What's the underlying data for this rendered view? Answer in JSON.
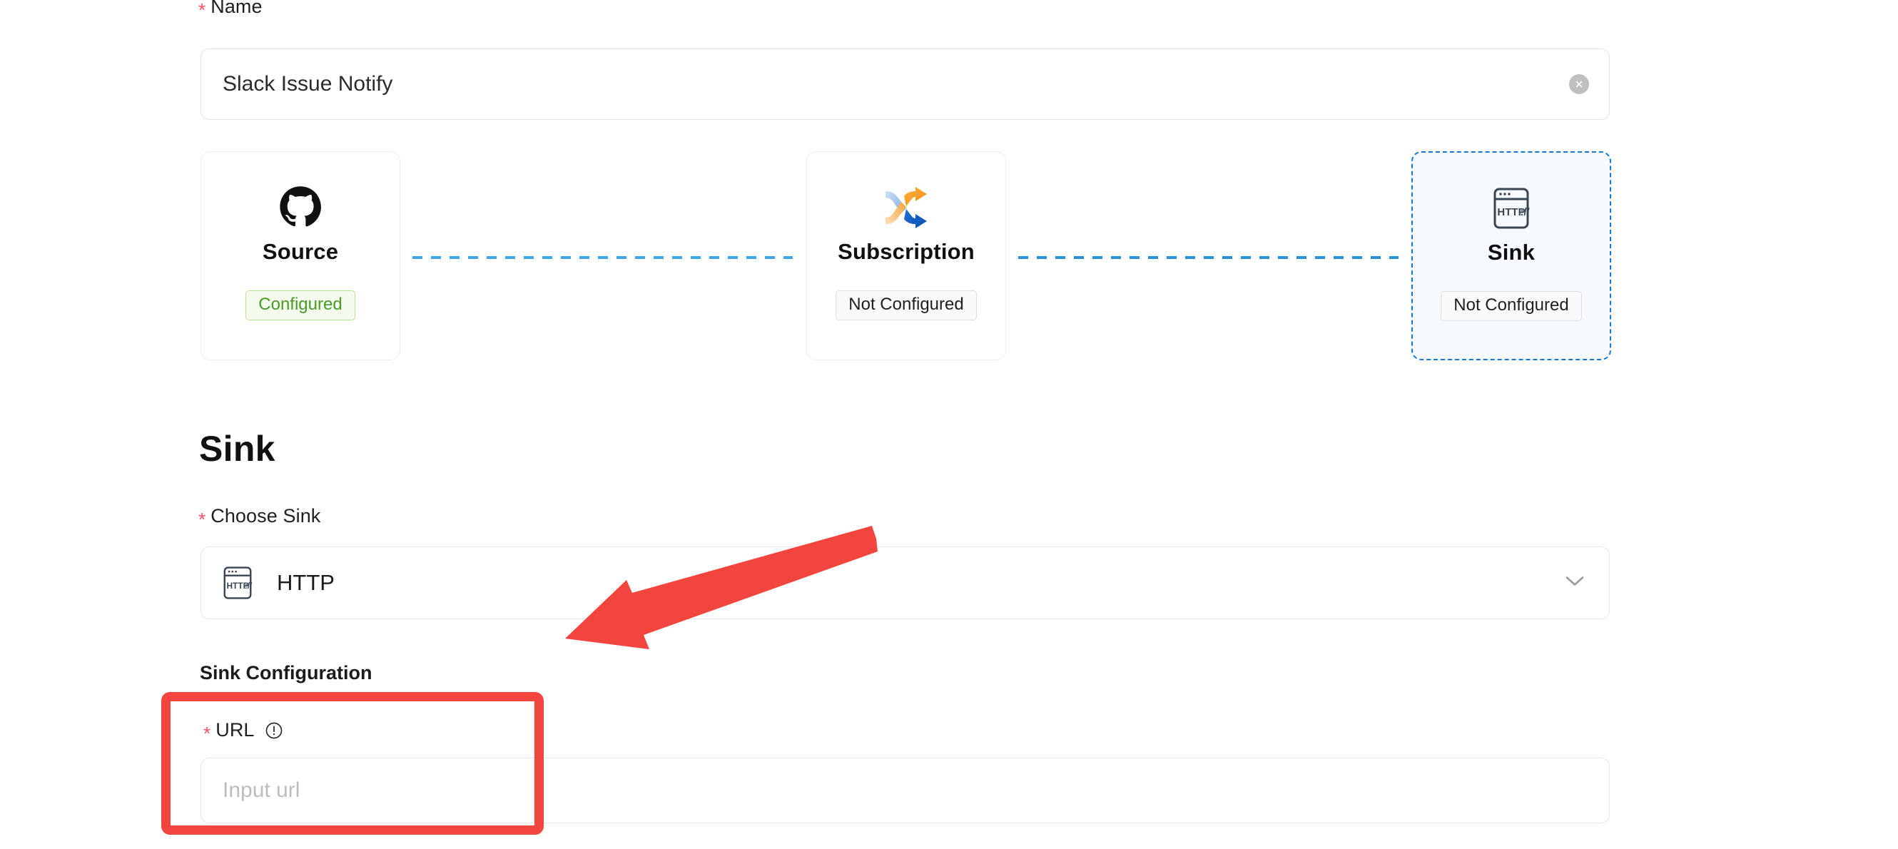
{
  "form": {
    "name_field": {
      "label": "Name",
      "required": true,
      "value": "Slack Issue Notify",
      "clear_icon": "close-circle-icon"
    }
  },
  "pipeline": {
    "steps": [
      {
        "title": "Source",
        "icon": "github-icon",
        "status": "Configured",
        "status_state": "configured",
        "selected": false
      },
      {
        "title": "Subscription",
        "icon": "shuffle-arrows-icon",
        "status": "Not Configured",
        "status_state": "not-configured",
        "selected": false
      },
      {
        "title": "Sink",
        "icon": "http-window-icon",
        "status": "Not Configured",
        "status_state": "not-configured",
        "selected": true
      }
    ]
  },
  "sink_section": {
    "heading": "Sink",
    "choose_sink": {
      "label": "Choose Sink",
      "required": true,
      "selected_value": "HTTP",
      "icon": "http-window-icon",
      "chevron": "chevron-down-icon"
    },
    "configuration": {
      "heading": "Sink Configuration",
      "url_field": {
        "label": "URL",
        "required": true,
        "info_icon": "exclamation-circle-icon",
        "value": "",
        "placeholder": "Input url"
      }
    }
  },
  "annotations": {
    "highlight_box": {
      "target": "url-field",
      "color": "#f2453d"
    },
    "pointer_arrow": {
      "target": "sink-configuration",
      "color": "#f2453d"
    }
  },
  "colors": {
    "accent_blue": "#1677d2",
    "success_green": "#4a9a28",
    "required_red": "#ff4d63",
    "annotation_red": "#f2453d"
  }
}
